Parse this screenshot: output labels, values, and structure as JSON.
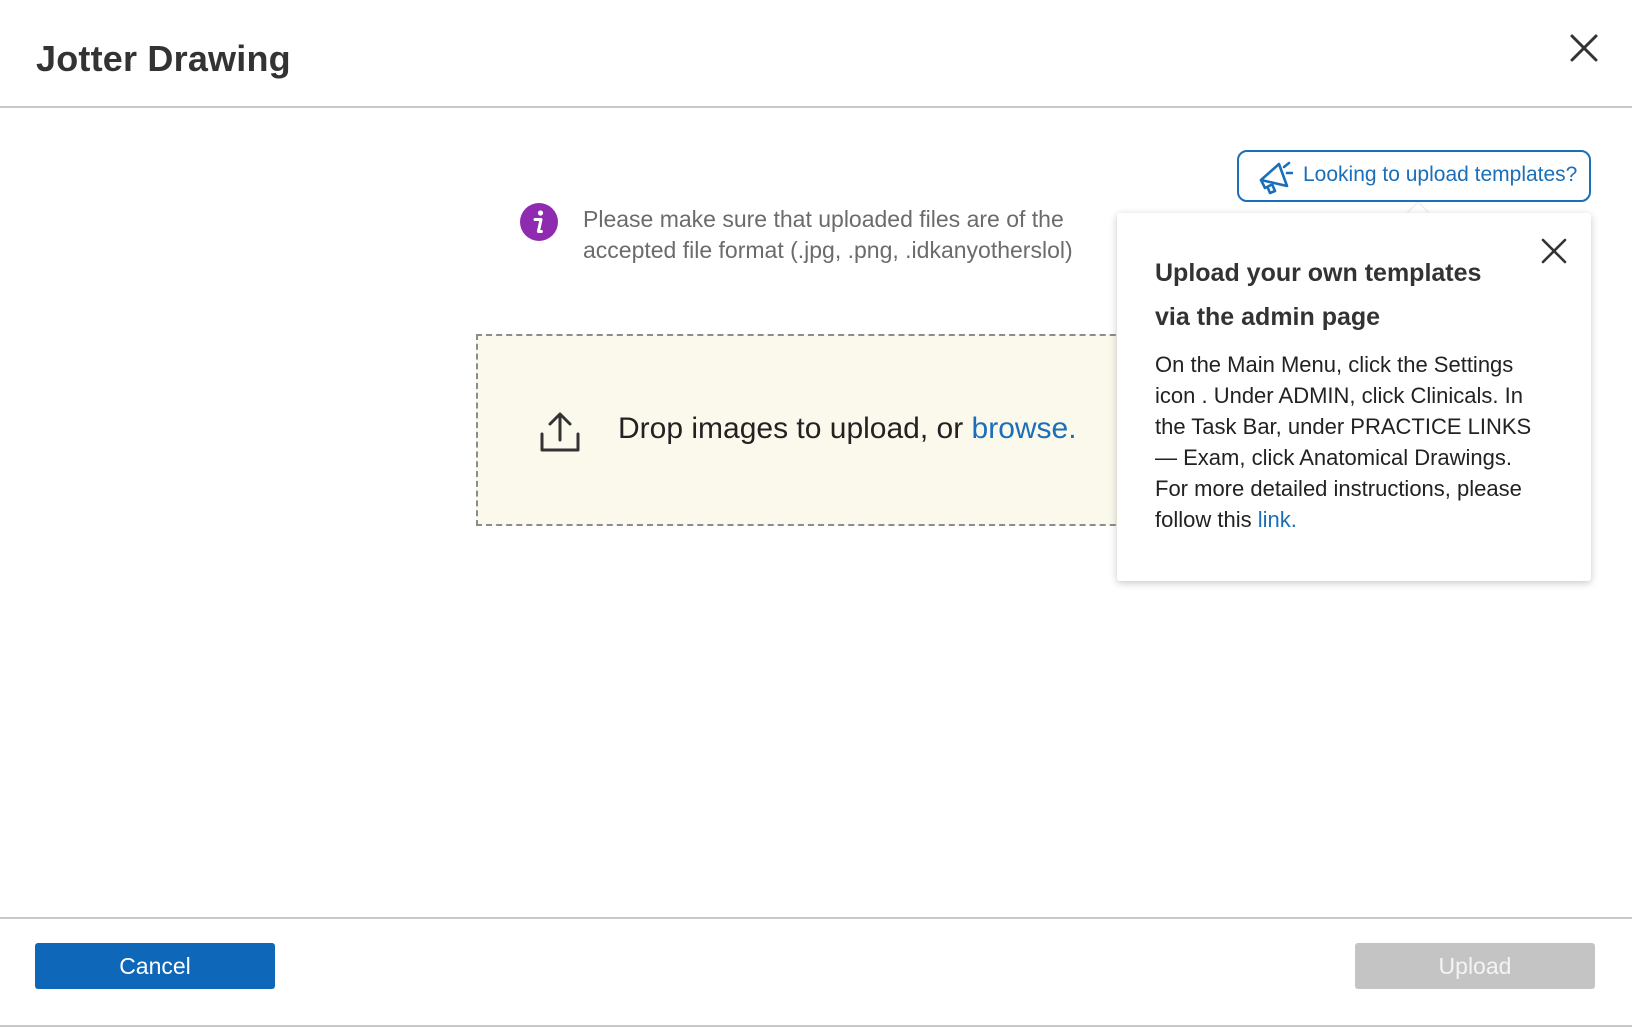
{
  "dialog": {
    "title": "Jotter Drawing"
  },
  "info": {
    "line1": "Please make sure that uploaded files are of the",
    "line2": "accepted file format (.jpg, .png, .idkanyotherslol)"
  },
  "dropzone": {
    "text": "Drop images to upload, or ",
    "browse_link": "browse."
  },
  "templates_button": {
    "label": "Looking to upload templates?"
  },
  "popover": {
    "title_line1": "Upload your own templates",
    "title_line2": "via the admin page",
    "body_line1": "On the Main Menu, click the Settings",
    "body_line2": "icon . Under ADMIN, click Clinicals. In",
    "body_line3": "the Task Bar, under PRACTICE LINKS",
    "body_line4": "— Exam, click Anatomical Drawings.",
    "body_line5": "For more detailed instructions, please",
    "body_line6_prefix": "follow this ",
    "link_text": "link."
  },
  "footer": {
    "cancel_label": "Cancel",
    "upload_label": "Upload"
  },
  "colors": {
    "accent": "#1a6fb8",
    "primary_button": "#0e67b8",
    "disabled_button": "#c4c4c4",
    "info_icon": "#8e2bb0",
    "dropzone_bg": "#fbf8ec"
  },
  "icons": {
    "close": "close-icon",
    "info": "info-icon",
    "upload": "upload-icon",
    "megaphone": "megaphone-icon"
  }
}
